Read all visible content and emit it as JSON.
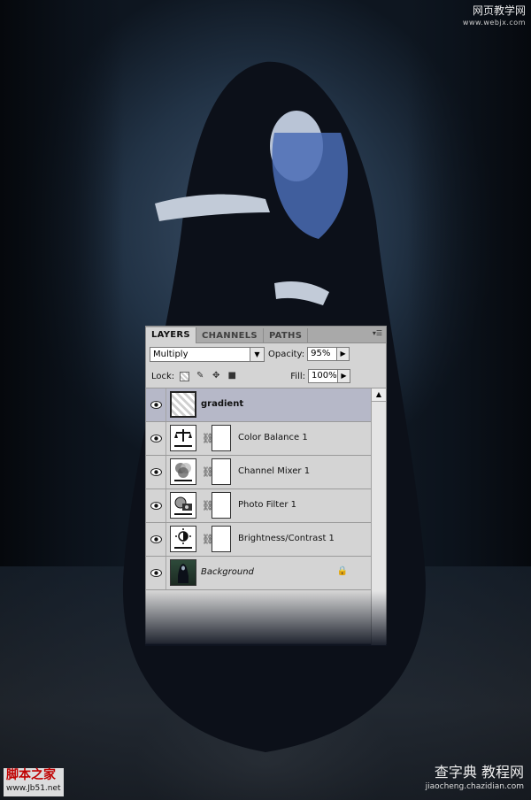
{
  "watermarks": {
    "top_right": "网页教学网",
    "top_right_url": "www.webjx.com",
    "bottom_left": "脚本之家",
    "bottom_left_url": "www.Jb51.net",
    "bottom_right": "查字典 教程网",
    "bottom_right_url": "jiaocheng.chazidian.com"
  },
  "panel": {
    "tabs": [
      "LAYERS",
      "CHANNELS",
      "PATHS"
    ],
    "active_tab": "LAYERS",
    "blend_mode": "Multiply",
    "opacity_label": "Opacity:",
    "opacity_value": "95%",
    "lock_label": "Lock:",
    "fill_label": "Fill:",
    "fill_value": "100%",
    "layers": [
      {
        "name": "gradient",
        "type": "gradient",
        "selected": true,
        "icon": "transparent-thumbnail"
      },
      {
        "name": "Color Balance 1",
        "type": "adjustment",
        "icon": "color-balance-icon"
      },
      {
        "name": "Channel Mixer 1",
        "type": "adjustment",
        "icon": "channel-mixer-icon"
      },
      {
        "name": "Photo Filter 1",
        "type": "adjustment",
        "icon": "photo-filter-icon"
      },
      {
        "name": "Brightness/Contrast 1",
        "type": "adjustment",
        "icon": "brightness-contrast-icon"
      },
      {
        "name": "Background",
        "type": "background",
        "icon": "photo-thumbnail",
        "locked": true
      }
    ]
  }
}
